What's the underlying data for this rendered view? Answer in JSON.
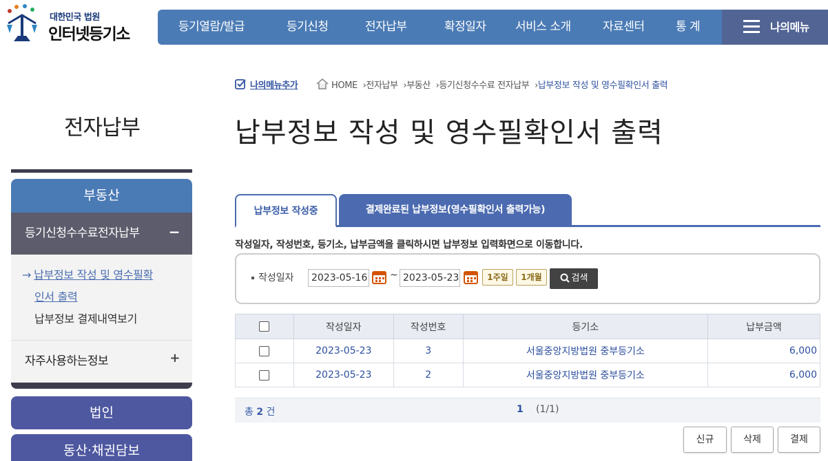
{
  "header": {
    "logo_small": "대한민국 법원",
    "logo_big": "인터넷등기소",
    "nav": [
      "등기열람/발급",
      "등기신청",
      "전자납부",
      "확정일자",
      "서비스 소개",
      "자료센터",
      "통 계"
    ],
    "my_menu": "나의메뉴"
  },
  "sidebar": {
    "title": "전자납부",
    "category": "부동산",
    "submenu": "등기신청수수료전자납부",
    "submenu_sign": "−",
    "links": {
      "active_line1": "납부정보 작성 및 영수필확",
      "active_line2": "인서 출력",
      "other": "납부정보 결제내역보기"
    },
    "favorites": "자주사용하는정보",
    "favorites_sign": "+",
    "category2": "법인",
    "category3": "동산·채권담보"
  },
  "breadcrumb": {
    "add_menu": "나의메뉴추가",
    "items": [
      "HOME",
      "전자납부",
      "부동산",
      "등기신청수수료 전자납부",
      "납부정보 작성 및 영수필확인서 출력"
    ]
  },
  "page_title": "납부정보 작성 및 영수필확인서 출력",
  "tabs": {
    "active": "납부정보 작성중",
    "inactive": "결제완료된 납부정보(영수필확인서 출력가능)"
  },
  "notice": "작성일자, 작성번호, 등기소, 납부금액을 클릭하시면 납부정보 입력화면으로 이동합니다.",
  "search": {
    "label": "작성일자",
    "from": "2023-05-16",
    "to": "2023-05-23",
    "tilde": "~",
    "week_btn": "1주일",
    "month_btn": "1개월",
    "search_btn": "검색"
  },
  "table": {
    "headers": [
      "작성일자",
      "작성번호",
      "등기소",
      "납부금액"
    ],
    "rows": [
      {
        "date": "2023-05-23",
        "no": "3",
        "office": "서울중앙지방법원 중부등기소",
        "amount": "6,000"
      },
      {
        "date": "2023-05-23",
        "no": "2",
        "office": "서울중앙지방법원 중부등기소",
        "amount": "6,000"
      }
    ]
  },
  "pager": {
    "total_prefix": "총",
    "total_count": "2",
    "total_suffix": "건",
    "current": "1",
    "info": "(1/1)"
  },
  "actions": {
    "new": "신규",
    "delete": "삭제",
    "pay": "결제"
  },
  "colors": {
    "nav_blue": "#4b7bb5",
    "my_menu": "#516493",
    "tab_blue": "#4b6ab0",
    "category_purple": "#4e58a0",
    "submenu_gray": "#5c5c6c"
  }
}
